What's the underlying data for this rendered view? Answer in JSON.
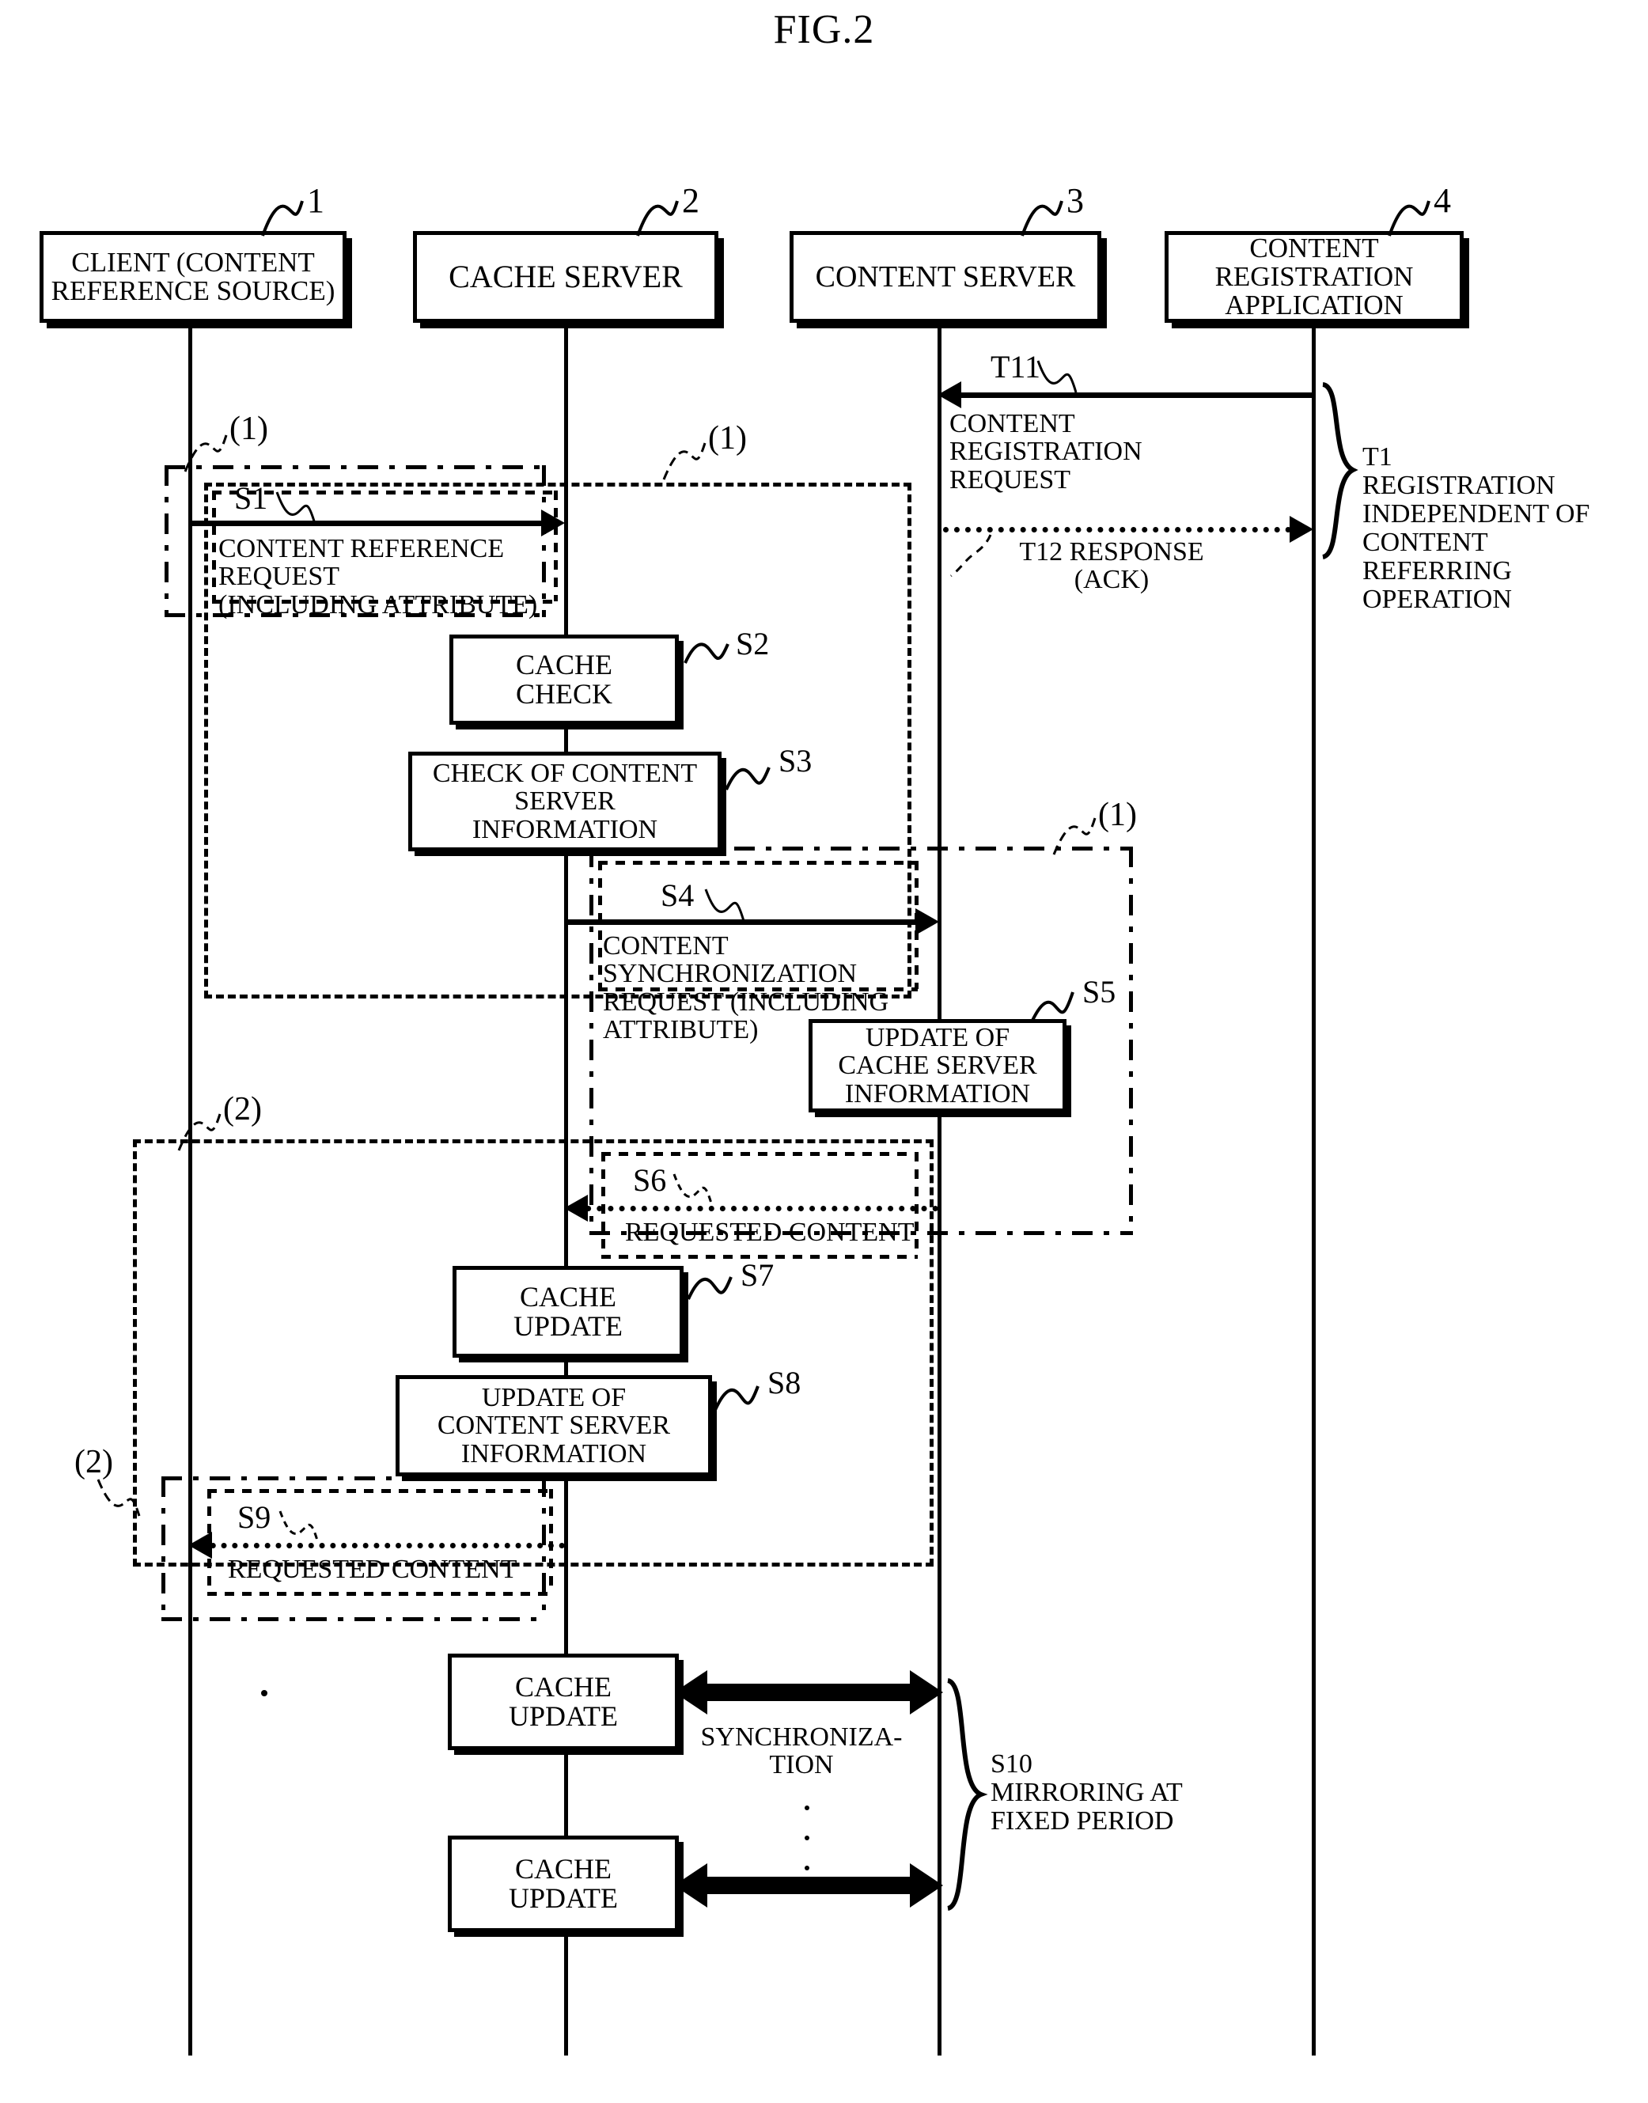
{
  "figure": {
    "title": "FIG.2",
    "type": "sequence-diagram"
  },
  "actors": [
    {
      "id": "client",
      "numeral": "1",
      "label": "CLIENT\n(CONTENT REFERENCE\nSOURCE)"
    },
    {
      "id": "cache",
      "numeral": "2",
      "label": "CACHE SERVER"
    },
    {
      "id": "content",
      "numeral": "3",
      "label": "CONTENT SERVER"
    },
    {
      "id": "regapp",
      "numeral": "4",
      "label": "CONTENT\nREGISTRATION\nAPPLICATION"
    }
  ],
  "group_labels": {
    "flow1_a": "(1)",
    "flow1_b": "(1)",
    "flow1_c": "(1)",
    "flow2_a": "(2)",
    "flow2_b": "(2)"
  },
  "messages": [
    {
      "id": "T11",
      "label": "T11",
      "text": "CONTENT\nREGISTRATION\nREQUEST",
      "from": "regapp",
      "to": "content",
      "style": "solid"
    },
    {
      "id": "T12",
      "label": "T12 RESPONSE",
      "text": "T12 RESPONSE\n(ACK)",
      "from": "content",
      "to": "regapp",
      "style": "dotted"
    },
    {
      "id": "S1",
      "label": "S1",
      "text": "CONTENT REFERENCE\nREQUEST\n(INCLUDING ATTRIBUTE)",
      "from": "client",
      "to": "cache",
      "style": "solid"
    },
    {
      "id": "S4",
      "label": "S4",
      "text": "CONTENT\nSYNCHRONIZATION\nREQUEST (INCLUDING\nATTRIBUTE)",
      "from": "cache",
      "to": "content",
      "style": "solid"
    },
    {
      "id": "S6",
      "label": "S6",
      "text": "REQUESTED CONTENT",
      "from": "content",
      "to": "cache",
      "style": "dotted"
    },
    {
      "id": "S9",
      "label": "S9",
      "text": "REQUESTED CONTENT",
      "from": "cache",
      "to": "client",
      "style": "dotted"
    }
  ],
  "processes": [
    {
      "id": "S2",
      "label": "S2",
      "text": "CACHE\nCHECK",
      "on": "cache"
    },
    {
      "id": "S3",
      "label": "S3",
      "text": "CHECK OF CONTENT\nSERVER\nINFORMATION",
      "on": "cache"
    },
    {
      "id": "S5",
      "label": "S5",
      "text": "UPDATE OF\nCACHE SERVER\nINFORMATION",
      "on": "content"
    },
    {
      "id": "S7",
      "label": "S7",
      "text": "CACHE\nUPDATE",
      "on": "cache"
    },
    {
      "id": "S8",
      "label": "S8",
      "text": "UPDATE OF\nCONTENT SERVER\nINFORMATION",
      "on": "cache"
    },
    {
      "id": "S10a",
      "label": "",
      "text": "CACHE\nUPDATE",
      "on": "cache"
    },
    {
      "id": "S10b",
      "label": "",
      "text": "CACHE\nUPDATE",
      "on": "cache"
    }
  ],
  "annotations": [
    {
      "id": "T1",
      "text": "T1\nREGISTRATION\nINDEPENDENT OF\nCONTENT\nREFERRING\nOPERATION"
    },
    {
      "id": "S10",
      "text": "S10\nMIRRORING AT\nFIXED PERIOD"
    },
    {
      "id": "SYNC",
      "text": "SYNCHRONIZA-\nTION"
    }
  ],
  "colors": {
    "ink": "#000000",
    "paper": "#ffffff"
  }
}
